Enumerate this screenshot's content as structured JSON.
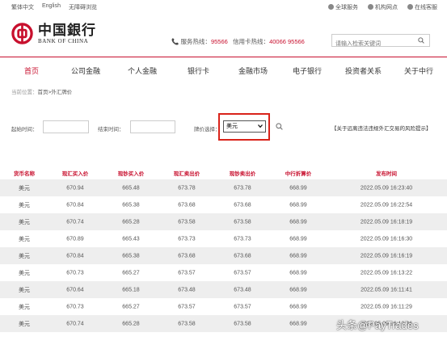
{
  "topbar": {
    "links": [
      "繁体中文",
      "English",
      "无障碍浏览"
    ],
    "right": [
      "全球服务",
      "机构网点",
      "在线客服"
    ]
  },
  "header": {
    "logo_cn": "中国銀行",
    "logo_en": "BANK OF CHINA",
    "hotline_label": "服务热线：",
    "hotline_number": "95566",
    "card_label": "信用卡热线：",
    "card_number": "40066 95566",
    "search_placeholder": "请输入检索关键词"
  },
  "nav": [
    "首页",
    "公司金融",
    "个人金融",
    "银行卡",
    "金融市场",
    "电子银行",
    "投资者关系",
    "关于中行"
  ],
  "breadcrumb": {
    "prefix": "当前位置：",
    "current": "首页>外汇牌价"
  },
  "filters": {
    "start_label": "起始时间：",
    "end_label": "结束时间：",
    "currency_label": "牌价选择：",
    "currency_value": "美元",
    "risk_link": "【关于远离违法违规外汇交易的风险提示】"
  },
  "table": {
    "headers": [
      "货币名称",
      "现汇买入价",
      "现钞买入价",
      "现汇卖出价",
      "现钞卖出价",
      "中行折算价",
      "发布时间"
    ],
    "rows": [
      [
        "美元",
        "670.94",
        "665.48",
        "673.78",
        "673.78",
        "668.99",
        "2022.05.09 16:23:40"
      ],
      [
        "美元",
        "670.84",
        "665.38",
        "673.68",
        "673.68",
        "668.99",
        "2022.05.09 16:22:54"
      ],
      [
        "美元",
        "670.74",
        "665.28",
        "673.58",
        "673.58",
        "668.99",
        "2022.05.09 16:18:19"
      ],
      [
        "美元",
        "670.89",
        "665.43",
        "673.73",
        "673.73",
        "668.99",
        "2022.05.09 16:16:30"
      ],
      [
        "美元",
        "670.84",
        "665.38",
        "673.68",
        "673.68",
        "668.99",
        "2022.05.09 16:16:19"
      ],
      [
        "美元",
        "670.73",
        "665.27",
        "673.57",
        "673.57",
        "668.99",
        "2022.05.09 16:13:22"
      ],
      [
        "美元",
        "670.64",
        "665.18",
        "673.48",
        "673.48",
        "668.99",
        "2022.05.09 16:11:41"
      ],
      [
        "美元",
        "670.73",
        "665.27",
        "673.57",
        "673.57",
        "668.99",
        "2022.05.09 16:11:29"
      ],
      [
        "美元",
        "670.74",
        "665.28",
        "673.58",
        "673.58",
        "668.99",
        "2022.05.09 16:10:36"
      ]
    ]
  },
  "watermark": "头条@PayTrades",
  "colors": {
    "brand_red": "#c8102e",
    "highlight_red": "#d9231a"
  }
}
